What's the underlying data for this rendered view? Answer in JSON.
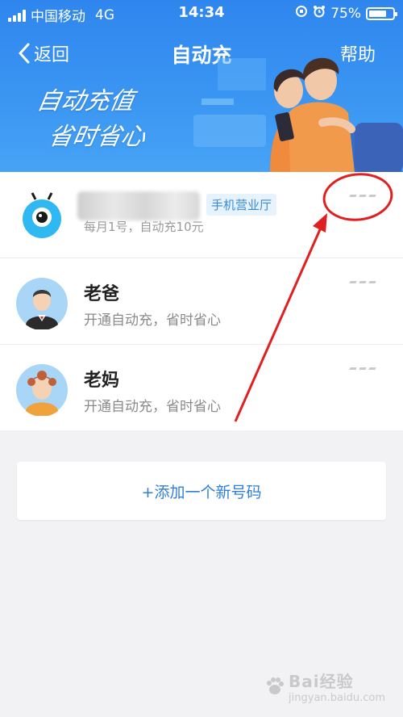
{
  "status_bar": {
    "carrier": "中国移动",
    "network": "4G",
    "time": "14:34",
    "battery": "75%",
    "battery_level": 0.75
  },
  "nav": {
    "back_label": "返回",
    "title": "自动充",
    "help_label": "帮助"
  },
  "banner": {
    "line1": "自动充值",
    "line2": "省时省心"
  },
  "accounts": [
    {
      "name": "",
      "badge": "手机营业厅",
      "desc": "每月1号，自动充10元"
    },
    {
      "name": "老爸",
      "desc": "开通自动充，省时省心"
    },
    {
      "name": "老妈",
      "desc": "开通自动充，省时省心"
    }
  ],
  "add_button": {
    "label": "+添加一个新号码"
  },
  "watermark": {
    "text": "Bai经验",
    "sub": "jingyan.baidu.com"
  },
  "colors": {
    "header_blue": "#3a95f2",
    "accent": "#2f7fd8",
    "annotation_red": "#e02020"
  }
}
